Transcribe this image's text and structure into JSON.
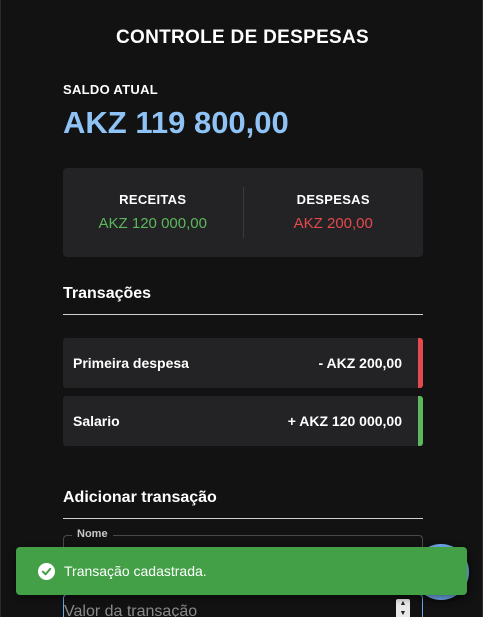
{
  "header": {
    "title": "CONTROLE DE DESPESAS"
  },
  "balance": {
    "label": "SALDO ATUAL",
    "value": "AKZ 119 800,00",
    "color": "#8fc3f5"
  },
  "summary": {
    "income": {
      "label": "RECEITAS",
      "value": "AKZ 120 000,00",
      "color": "#5cb85c"
    },
    "expenses": {
      "label": "DESPESAS",
      "value": "AKZ 200,00",
      "color": "#e5484d"
    }
  },
  "transactions": {
    "title": "Transações",
    "items": [
      {
        "name": "Primeira despesa",
        "amount": "- AKZ 200,00",
        "type": "expense"
      },
      {
        "name": "Salario",
        "amount": "+ AKZ 120 000,00",
        "type": "income"
      }
    ]
  },
  "add_form": {
    "title": "Adicionar transação",
    "name_label": "Nome",
    "value_placeholder": "Valor da transação"
  },
  "fab": {
    "icon": "plus-icon",
    "color": "#6ea8e8"
  },
  "toast": {
    "message": "Transação cadastrada.",
    "icon": "check-circle-icon",
    "color": "#43a047"
  }
}
